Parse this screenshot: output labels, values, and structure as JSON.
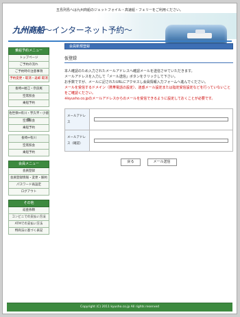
{
  "top_note": "五島列島へは九州商船のジェットフォイル・高速船・フェリーをご利用ください。",
  "brand": {
    "logo": "九州商船",
    "subtitle": "～インターネット予約～",
    "accent": "#3b7fc7",
    "green": "#3d8a3f"
  },
  "sidebar": {
    "sections": [
      {
        "head": "乗船予約メニュー",
        "items": [
          "トップページ",
          "ご予約の流れ",
          "ご予約時の注意事項",
          {
            "label": "予約変更・取消・返却 取消",
            "red": true
          }
        ]
      },
      {
        "sub": "長崎⇔福江・奈良尾",
        "items": [
          "空席照会",
          "乗船予約"
        ]
      },
      {
        "sub": "佐世保⇔有川・宇久平・小値賀",
        "items": [
          "空席照会",
          "乗船予約"
        ]
      },
      {
        "sub": "長崎⇔有川",
        "items": [
          "空席照会",
          "乗船予約"
        ]
      },
      {
        "head": "会員メニュー",
        "items": [
          "会員登録",
          "会員登録情報・変更・解約",
          "パスワード再設定",
          "ログアウト"
        ]
      },
      {
        "head": "その他",
        "items": [
          "返金依頼",
          "コンビニでの支払い方法",
          "ATMでの支払い方法",
          "特商法に基づく表記"
        ]
      }
    ]
  },
  "main": {
    "section_title": "会員新規登録",
    "page_title": "仮登録",
    "desc_lines": [
      "本人確認のため入力されたメールアドレスへ確認メールを送信させていただきます。",
      "メールアドレスを入力して「メール送信」ボタンをクリックして下さい。",
      "お手数ですが、メールに記されたURLにアクセスし会員情報入力フォームへ進んでください。"
    ],
    "red_lines": [
      "メールを受信するドメイン（携帯電話の設定）、迷惑メール設定または指定受信設定などを行っていないことをご確認ください。",
      "※kyusho.co.jpのメールアドレスからのメールを受信できるように設定しておくことが必要です。"
    ],
    "form": {
      "email_label": "メールアドレス",
      "email_value": "",
      "email_confirm_label": "メールアドレス（確認）",
      "email_confirm_value": ""
    },
    "buttons": {
      "back": "戻る",
      "send": "メール送信"
    }
  },
  "footer": "Copyright (C) 2011 kyusho.co.jp All rights reserved"
}
